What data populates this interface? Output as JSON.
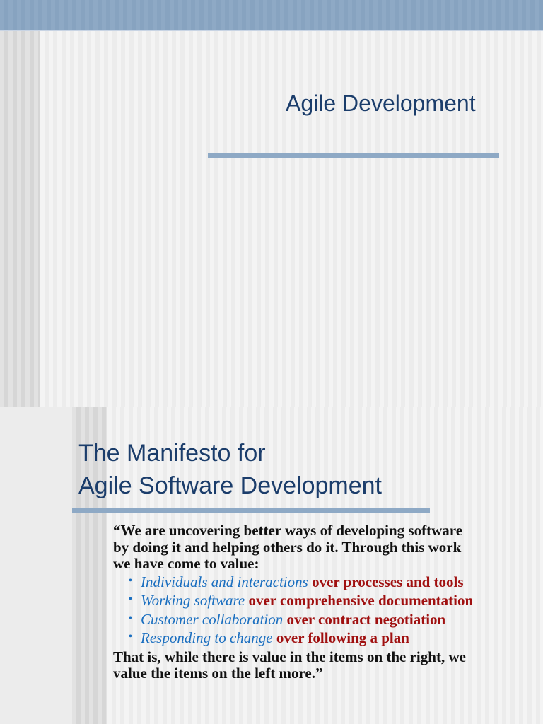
{
  "slide1": {
    "title": "Agile Development"
  },
  "slide2": {
    "title_line1": "The Manifesto for",
    "title_line2": "Agile Software Development",
    "intro": "“We are uncovering better ways of developing software by doing it and helping others do it. Through this work we have come to value:",
    "items": [
      {
        "left": "Individuals and interactions",
        "right": "over processes and tools"
      },
      {
        "left": "Working software",
        "right": "over comprehensive documentation"
      },
      {
        "left": "Customer collaboration",
        "right": "over contract negotiation"
      },
      {
        "left": "Responding to change",
        "right": "over following a plan"
      }
    ],
    "conclusion": "That is, while there is value in the items on the right, we value the items on the left more.”"
  }
}
